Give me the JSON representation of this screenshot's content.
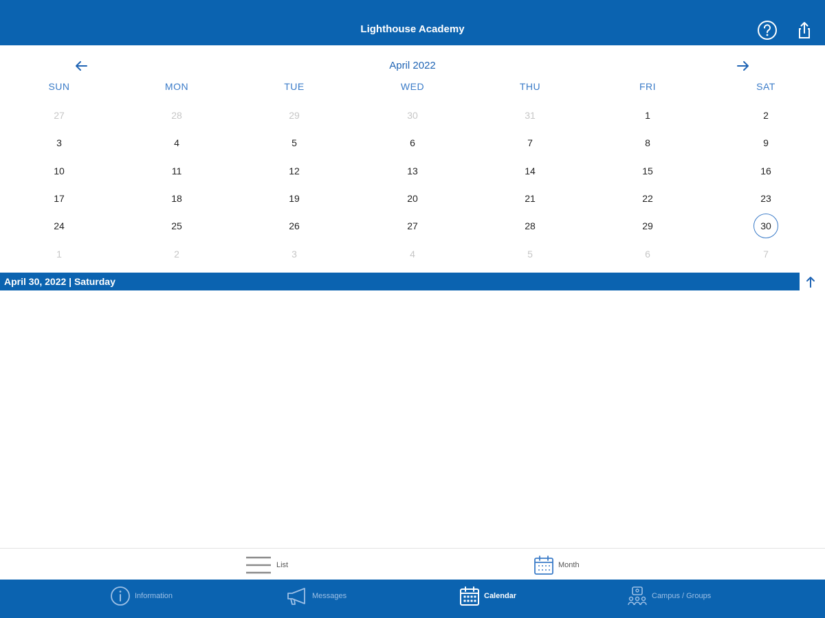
{
  "header": {
    "title": "Lighthouse Academy",
    "help_icon": "help-circle-icon",
    "share_icon": "share-icon"
  },
  "calendar": {
    "month_title": "April 2022",
    "weekdays": [
      "SUN",
      "MON",
      "TUE",
      "WED",
      "THU",
      "FRI",
      "SAT"
    ],
    "weeks": [
      [
        "27",
        "28",
        "29",
        "30",
        "31",
        "1",
        "2"
      ],
      [
        "3",
        "4",
        "5",
        "6",
        "7",
        "8",
        "9"
      ],
      [
        "10",
        "11",
        "12",
        "13",
        "14",
        "15",
        "16"
      ],
      [
        "17",
        "18",
        "19",
        "20",
        "21",
        "22",
        "23"
      ],
      [
        "24",
        "25",
        "26",
        "27",
        "28",
        "29",
        "30"
      ],
      [
        "1",
        "2",
        "3",
        "4",
        "5",
        "6",
        "7"
      ]
    ],
    "selected_date_label": "April 30, 2022 | Saturday"
  },
  "view_switch": {
    "list_label": "List",
    "month_label": "Month"
  },
  "tabs": {
    "information": "Information",
    "messages": "Messages",
    "calendar": "Calendar",
    "campus": "Campus / Groups"
  },
  "colors": {
    "brand_blue": "#0b63b0",
    "accent_blue": "#3a7bc8",
    "muted_day": "#c6c6c6"
  }
}
